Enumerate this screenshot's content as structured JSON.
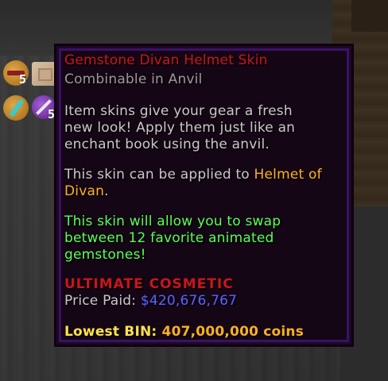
{
  "hotbar": {
    "slot_a_count": "5",
    "slot_d_count": "5"
  },
  "tooltip": {
    "title": "Gemstone Divan Helmet Skin",
    "subtitle": "Combinable in Anvil",
    "desc_line1": "Item skins give your gear a fresh",
    "desc_line2": "new look! Apply them just like an",
    "desc_line3": "enchant book using the anvil.",
    "apply_prefix": "This skin can be applied to ",
    "apply_item_part1": "Helmet of",
    "apply_item_part2": "Divan",
    "apply_suffix": ".",
    "feature_line1": "This skin will allow you to swap",
    "feature_line2": "between 12 favorite animated",
    "feature_line3": "gemstones!",
    "rarity": "ULTIMATE COSMETIC",
    "price_label": "Price Paid: ",
    "price_value": "$420,676,767",
    "lowest_bin_label": "Lowest BIN: ",
    "lowest_bin_value": "407,000,000 coins"
  },
  "colors": {
    "title": "#c8161c",
    "subtitle": "#9a9a9a",
    "body": "#c8c8c8",
    "item_name": "#ffb020",
    "feature": "#55ff55",
    "rarity": "#c8161c",
    "price": "#5a62ff",
    "lowest_bin": "#ffe24a"
  }
}
